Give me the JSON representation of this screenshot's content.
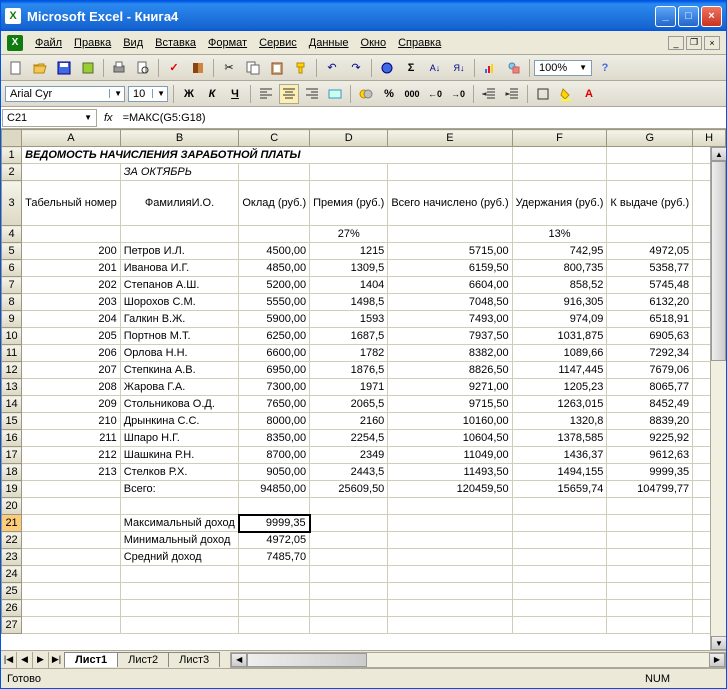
{
  "app": {
    "title": "Microsoft Excel - Книга4"
  },
  "menu": {
    "file": "Файл",
    "edit": "Правка",
    "view": "Вид",
    "insert": "Вставка",
    "format": "Формат",
    "service": "Сервис",
    "data": "Данные",
    "window": "Окно",
    "help": "Справка"
  },
  "toolbar": {
    "zoom": "100%"
  },
  "font": {
    "name": "Arial Cyr",
    "size": "10"
  },
  "formulaBar": {
    "cellRef": "C21",
    "formula": "=МАКС(G5:G18)"
  },
  "cols": [
    "A",
    "B",
    "C",
    "D",
    "E",
    "F",
    "G",
    "H"
  ],
  "rows": [
    "1",
    "2",
    "3",
    "4",
    "5",
    "6",
    "7",
    "8",
    "9",
    "10",
    "11",
    "12",
    "13",
    "14",
    "15",
    "16",
    "17",
    "18",
    "19",
    "20",
    "21",
    "22",
    "23",
    "24",
    "25",
    "26",
    "27"
  ],
  "content": {
    "title": "ВЕДОМОСТЬ НАЧИСЛЕНИЯ ЗАРАБОТНОЙ ПЛАТЫ",
    "subtitle": "ЗА ОКТЯБРЬ",
    "headers": {
      "A": "Табельный номер",
      "B": "ФамилияИ.О.",
      "C": "Оклад (руб.)",
      "D": "Премия (руб.)",
      "E": "Всего начислено (руб.)",
      "F": "Удержания (руб.)",
      "G": "К выдаче (руб.)"
    },
    "pct": {
      "D": "27%",
      "F": "13%"
    },
    "data": [
      {
        "n": "200",
        "name": "Петров И.Л.",
        "c": "4500,00",
        "d": "1215",
        "e": "5715,00",
        "f": "742,95",
        "g": "4972,05"
      },
      {
        "n": "201",
        "name": "Иванова И.Г.",
        "c": "4850,00",
        "d": "1309,5",
        "e": "6159,50",
        "f": "800,735",
        "g": "5358,77"
      },
      {
        "n": "202",
        "name": "Степанов А.Ш.",
        "c": "5200,00",
        "d": "1404",
        "e": "6604,00",
        "f": "858,52",
        "g": "5745,48"
      },
      {
        "n": "203",
        "name": "Шорохов С.М.",
        "c": "5550,00",
        "d": "1498,5",
        "e": "7048,50",
        "f": "916,305",
        "g": "6132,20"
      },
      {
        "n": "204",
        "name": "Галкин В.Ж.",
        "c": "5900,00",
        "d": "1593",
        "e": "7493,00",
        "f": "974,09",
        "g": "6518,91"
      },
      {
        "n": "205",
        "name": "Портнов М.Т.",
        "c": "6250,00",
        "d": "1687,5",
        "e": "7937,50",
        "f": "1031,875",
        "g": "6905,63"
      },
      {
        "n": "206",
        "name": "Орлова Н.Н.",
        "c": "6600,00",
        "d": "1782",
        "e": "8382,00",
        "f": "1089,66",
        "g": "7292,34"
      },
      {
        "n": "207",
        "name": "Степкина А.В.",
        "c": "6950,00",
        "d": "1876,5",
        "e": "8826,50",
        "f": "1147,445",
        "g": "7679,06"
      },
      {
        "n": "208",
        "name": "Жарова Г.А.",
        "c": "7300,00",
        "d": "1971",
        "e": "9271,00",
        "f": "1205,23",
        "g": "8065,77"
      },
      {
        "n": "209",
        "name": "Стольникова О.Д.",
        "c": "7650,00",
        "d": "2065,5",
        "e": "9715,50",
        "f": "1263,015",
        "g": "8452,49"
      },
      {
        "n": "210",
        "name": "Дрынкина С.С.",
        "c": "8000,00",
        "d": "2160",
        "e": "10160,00",
        "f": "1320,8",
        "g": "8839,20"
      },
      {
        "n": "211",
        "name": "Шпаро Н.Г.",
        "c": "8350,00",
        "d": "2254,5",
        "e": "10604,50",
        "f": "1378,585",
        "g": "9225,92"
      },
      {
        "n": "212",
        "name": "Шашкина Р.Н.",
        "c": "8700,00",
        "d": "2349",
        "e": "11049,00",
        "f": "1436,37",
        "g": "9612,63"
      },
      {
        "n": "213",
        "name": "Стелков Р.Х.",
        "c": "9050,00",
        "d": "2443,5",
        "e": "11493,50",
        "f": "1494,155",
        "g": "9999,35"
      }
    ],
    "total": {
      "name": "Всего:",
      "c": "94850,00",
      "d": "25609,50",
      "e": "120459,50",
      "f": "15659,74",
      "g": "104799,77"
    },
    "summary": [
      {
        "label": "Максимальный доход",
        "val": "9999,35"
      },
      {
        "label": "Минимальный доход",
        "val": "4972,05"
      },
      {
        "label": "Средний доход",
        "val": "7485,70"
      }
    ]
  },
  "tabs": {
    "t1": "Лист1",
    "t2": "Лист2",
    "t3": "Лист3"
  },
  "status": {
    "ready": "Готово",
    "num": "NUM"
  }
}
